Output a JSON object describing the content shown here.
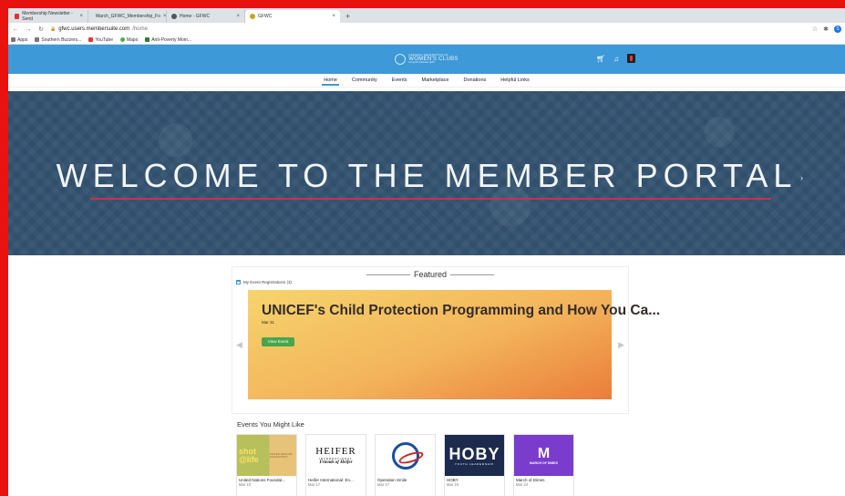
{
  "browser": {
    "tabs": [
      {
        "label": "Membership Newsletter - Send"
      },
      {
        "label": "March_GFWC_Membership_Fo"
      },
      {
        "label": "Home - GFWC"
      },
      {
        "label": "GFWC",
        "active": true
      }
    ],
    "new_tab": "+",
    "url_host": "gfwc.users.membersuite.com",
    "url_path": "/home",
    "profile_initial": "S",
    "bookmarks": [
      "Apps",
      "Southern Buzzers...",
      "YouTube",
      "Maps",
      "Anti-Poverty Mom..."
    ]
  },
  "site": {
    "logo": {
      "line1": "GENERAL FEDERATION OF",
      "line2": "WOMEN'S CLUBS",
      "line3": "Living the Volunteer Spirit"
    },
    "nav": [
      "Home",
      "Community",
      "Events",
      "Marketplace",
      "Donations",
      "Helpful Links"
    ],
    "active_nav": "Home",
    "hero_title": "WELCOME TO THE MEMBER PORTAL",
    "hero_prev": "‹",
    "hero_next": "›"
  },
  "featured": {
    "title": "Featured",
    "my_registrations": "My Event Registrations (3)",
    "card_title": "UNICEF's Child Protection Programming and How You Ca...",
    "card_date": "Mar 31",
    "card_button": "View Event",
    "prev": "◀",
    "next": "▶"
  },
  "events": {
    "title": "Events You Might Like",
    "items": [
      {
        "name": "United Nations Foundat...",
        "date": "Mar 10",
        "logo_text": "shot @life",
        "logo_sub": "UNITED NATIONS FOUNDATION"
      },
      {
        "name": "Heifer International: En...",
        "date": "Mar 17",
        "logo_text": "HEIFER",
        "logo_sub": "INTERNATIONAL",
        "logo_tag": "Friends of Heifer"
      },
      {
        "name": "Operation Smile",
        "date": "Mar 17"
      },
      {
        "name": "HOBY",
        "date": "Mar 24",
        "logo_text": "HOBY",
        "logo_sub": "YOUTH LEADERSHIP"
      },
      {
        "name": "March of Dimes",
        "date": "Mar 24",
        "logo_text": "M",
        "logo_sub": "MARCH OF DIMES"
      }
    ]
  },
  "colors": {
    "header_blue": "#3d99d7",
    "hero_bg": "#2f4f6c",
    "hero_line": "#cf2f4b",
    "button_green": "#47a64c",
    "frame_red": "#e8130f"
  }
}
